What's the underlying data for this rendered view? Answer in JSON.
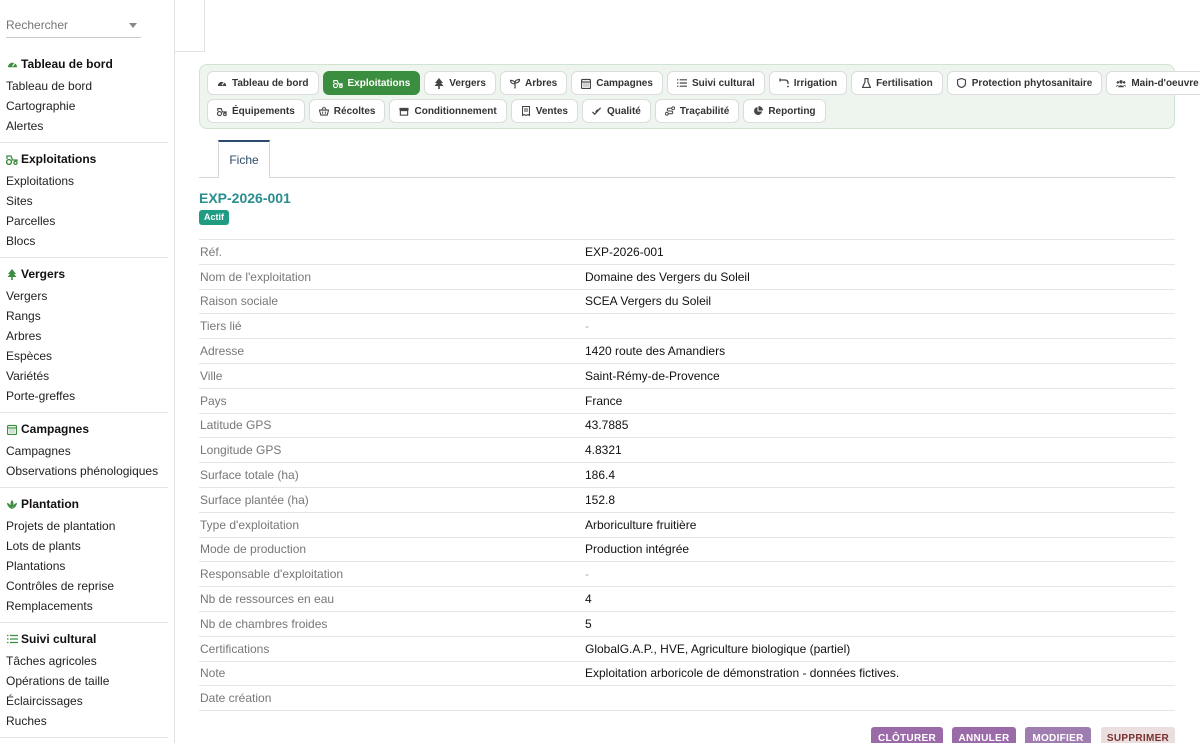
{
  "search": {
    "placeholder": "Rechercher"
  },
  "sidebar": {
    "sections": [
      {
        "title": "Tableau de bord",
        "icon": "dashboard-icon",
        "items": [
          "Tableau de bord",
          "Cartographie",
          "Alertes"
        ]
      },
      {
        "title": "Exploitations",
        "icon": "tractor-icon",
        "items": [
          "Exploitations",
          "Sites",
          "Parcelles",
          "Blocs"
        ]
      },
      {
        "title": "Vergers",
        "icon": "tree-icon",
        "items": [
          "Vergers",
          "Rangs",
          "Arbres",
          "Espèces",
          "Variétés",
          "Porte-greffes"
        ]
      },
      {
        "title": "Campagnes",
        "icon": "calendar-icon",
        "items": [
          "Campagnes",
          "Observations phénologiques"
        ]
      },
      {
        "title": "Plantation",
        "icon": "plant-icon",
        "items": [
          "Projets de plantation",
          "Lots de plants",
          "Plantations",
          "Contrôles de reprise",
          "Remplacements"
        ]
      },
      {
        "title": "Suivi cultural",
        "icon": "list-icon",
        "items": [
          "Tâches agricoles",
          "Opérations de taille",
          "Éclaircissages",
          "Ruches"
        ]
      }
    ]
  },
  "modules": {
    "row1": [
      {
        "label": "Tableau de bord",
        "icon": "dashboard-icon"
      },
      {
        "label": "Exploitations",
        "icon": "tractor-icon",
        "active": true
      },
      {
        "label": "Vergers",
        "icon": "tree-icon"
      },
      {
        "label": "Arbres",
        "icon": "sprout-icon"
      },
      {
        "label": "Campagnes",
        "icon": "calendar-icon"
      },
      {
        "label": "Suivi cultural",
        "icon": "list-icon"
      },
      {
        "label": "Irrigation",
        "icon": "faucet-icon"
      },
      {
        "label": "Fertilisation",
        "icon": "flask-icon"
      },
      {
        "label": "Protection phytosanitaire",
        "icon": "shield-icon"
      },
      {
        "label": "Main-d'oeuvre",
        "icon": "users-icon"
      }
    ],
    "row2": [
      {
        "label": "Équipements",
        "icon": "tractor-icon"
      },
      {
        "label": "Récoltes",
        "icon": "basket-icon"
      },
      {
        "label": "Conditionnement",
        "icon": "box-icon"
      },
      {
        "label": "Ventes",
        "icon": "receipt-icon"
      },
      {
        "label": "Qualité",
        "icon": "check-double-icon"
      },
      {
        "label": "Traçabilité",
        "icon": "route-icon"
      },
      {
        "label": "Reporting",
        "icon": "pie-chart-icon"
      }
    ]
  },
  "tabs": {
    "fiche": "Fiche"
  },
  "record": {
    "title": "EXP-2026-001",
    "status": "Actif",
    "fields": [
      {
        "label": "Réf.",
        "value": "EXP-2026-001"
      },
      {
        "label": "Nom de l'exploitation",
        "value": "Domaine des Vergers du Soleil"
      },
      {
        "label": "Raison sociale",
        "value": "SCEA Vergers du Soleil"
      },
      {
        "label": "Tiers lié",
        "value": "-"
      },
      {
        "label": "Adresse",
        "value": "1420 route des Amandiers"
      },
      {
        "label": "Ville",
        "value": "Saint-Rémy-de-Provence"
      },
      {
        "label": "Pays",
        "value": "France"
      },
      {
        "label": "Latitude GPS",
        "value": "43.7885"
      },
      {
        "label": "Longitude GPS",
        "value": "4.8321"
      },
      {
        "label": "Surface totale (ha)",
        "value": "186.4"
      },
      {
        "label": "Surface plantée (ha)",
        "value": "152.8"
      },
      {
        "label": "Type d'exploitation",
        "value": "Arboriculture fruitière"
      },
      {
        "label": "Mode de production",
        "value": "Production intégrée"
      },
      {
        "label": "Responsable d'exploitation",
        "value": "-"
      },
      {
        "label": "Nb de ressources en eau",
        "value": "4"
      },
      {
        "label": "Nb de chambres froides",
        "value": "5"
      },
      {
        "label": "Certifications",
        "value": "GlobalG.A.P., HVE, Agriculture biologique (partiel)"
      },
      {
        "label": "Note",
        "value": "Exploitation arboricole de démonstration - données fictives."
      },
      {
        "label": "Date création",
        "value": ""
      }
    ]
  },
  "actions": {
    "close": "CLÔTURER",
    "cancel": "ANNULER",
    "edit": "MODIFIER",
    "delete": "SUPPRIMER"
  },
  "colors": {
    "accent_green": "#3b8e3f",
    "title_teal": "#2a8d8f",
    "badge_green": "#1f9c82",
    "button_purple": "#9b6aa8"
  }
}
